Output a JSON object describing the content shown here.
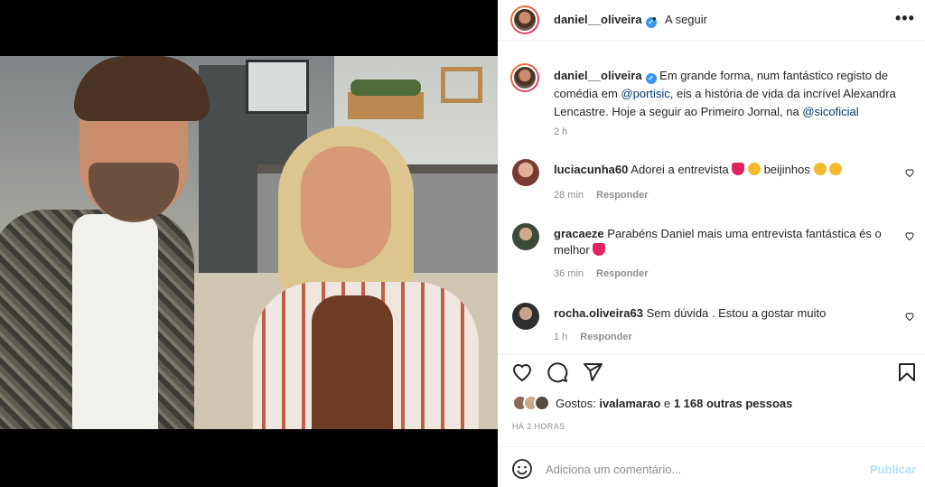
{
  "post": {
    "username": "daniel__oliveira",
    "follow_status": "A seguir",
    "dot": "•"
  },
  "caption": {
    "username": "daniel__oliveira",
    "part1": " Em grande forma, num fantástico registo de comédia em ",
    "mention1": "@portisic",
    "part2": ", eis a história de vida da incrível Alexandra Lencastre. Hoje a seguir ao Primeiro Jornal, na ",
    "mention2": "@sicoficial",
    "time": "2 h"
  },
  "comments": [
    {
      "username": "luciacunha60",
      "text": "Adorei a entrevista",
      "text2": "beijinhos",
      "time": "28 min",
      "reply": "Responder"
    },
    {
      "username": "gracaeze",
      "text": "Parabéns Daniel mais uma entrevista fantástica és o melhor",
      "time": "36 min",
      "reply": "Responder"
    },
    {
      "username": "rocha.oliveira63",
      "text": "Sem dúvida . Estou a gostar muito",
      "time": "1 h",
      "reply": "Responder"
    }
  ],
  "likes": {
    "prefix": "Gostos: ",
    "user": "ivalamarao",
    "middle": " e ",
    "others": "1 168 outras pessoas"
  },
  "posted_ago": "HÁ 2 HORAS",
  "add_comment": {
    "placeholder": "Adiciona um comentário...",
    "publish": "Publicar"
  },
  "colors": {
    "verified": "#3897f0",
    "mention": "#00376b",
    "publish_disabled": "#b2dffc"
  }
}
